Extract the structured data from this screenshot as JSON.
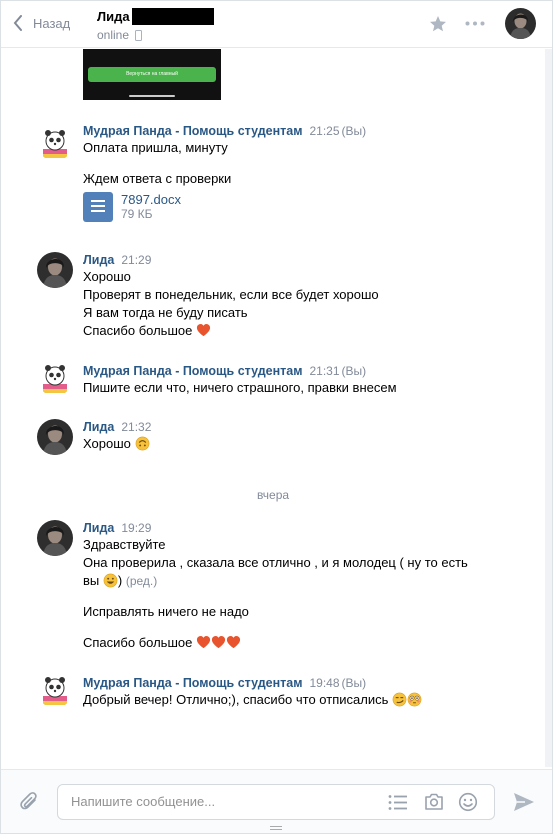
{
  "header": {
    "back_label": "Назад",
    "contact_name": "Лида",
    "status": "online"
  },
  "messages": [
    {
      "author": "Мудрая Панда - Помощь студентам",
      "time": "21:25",
      "you_label": "(Вы)",
      "lines": [
        "Оплата пришла, минуту",
        "Ждем ответа с проверки"
      ],
      "file": {
        "name": "7897.docx",
        "size": "79 КБ"
      }
    },
    {
      "author": "Лида",
      "time": "21:29",
      "lines": [
        "Хорошо",
        "Проверят в понедельник, если все будет хорошо",
        "Я вам тогда не буду писать",
        "Спасибо большое"
      ]
    },
    {
      "author": "Мудрая Панда - Помощь студентам",
      "time": "21:31",
      "you_label": "(Вы)",
      "lines": [
        "Пишите если что, ничего страшного, правки внесем"
      ]
    },
    {
      "author": "Лида",
      "time": "21:32",
      "lines": [
        "Хорошо"
      ]
    },
    {
      "author": "Лида",
      "time": "19:29",
      "lines": [
        "Здравствуйте",
        "Она проверила , сказала все отлично , и я молодец ( ну то есть",
        "вы",
        ")",
        "Исправлять ничего не надо",
        "Спасибо большое"
      ],
      "edited_label": "(ред.)"
    },
    {
      "author": "Мудрая Панда - Помощь студентам",
      "time": "19:48",
      "you_label": "(Вы)",
      "lines": [
        "Добрый вечер! Отлично;), спасибо что отписались"
      ]
    }
  ],
  "date_separator": "вчера",
  "image_preview_button": "Вернуться на главный",
  "composer": {
    "placeholder": "Напишите сообщение..."
  },
  "colors": {
    "link": "#2a5885",
    "muted": "#828a99",
    "accent": "#5181b8"
  }
}
